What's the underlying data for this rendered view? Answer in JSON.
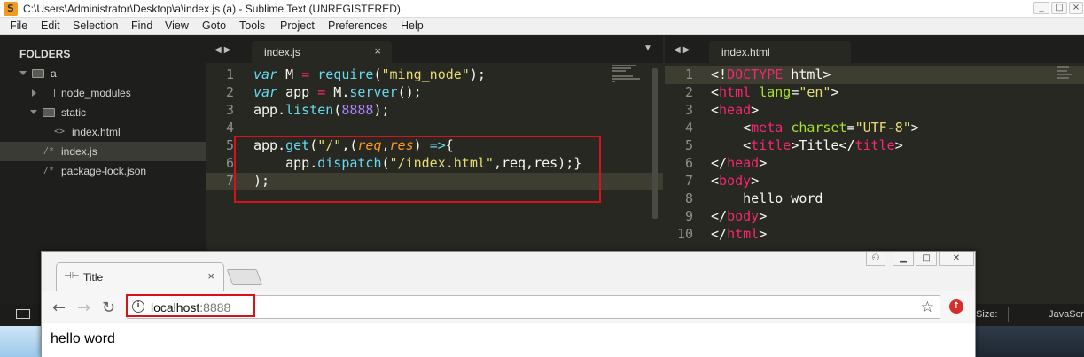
{
  "sublime": {
    "window_title": "C:\\Users\\Administrator\\Desktop\\a\\index.js (a) - Sublime Text (UNREGISTERED)",
    "menu": [
      "File",
      "Edit",
      "Selection",
      "Find",
      "View",
      "Goto",
      "Tools",
      "Project",
      "Preferences",
      "Help"
    ],
    "folders_header": "FOLDERS",
    "tree": {
      "root": "a",
      "node_modules": "node_modules",
      "static": "static",
      "index_html": "index.html",
      "index_js": "index.js",
      "package_lock": "package-lock.json"
    },
    "tabs": {
      "left": "index.js",
      "right": "index.html",
      "close": "×"
    },
    "left_code": {
      "line_numbers": [
        "1",
        "2",
        "3",
        "4",
        "5",
        "6",
        "7"
      ],
      "l1": {
        "a": "var",
        "b": " M ",
        "c": "=",
        "d": " ",
        "e": "require",
        "f": "(",
        "g": "\"ming_node\"",
        "h": ");"
      },
      "l2": {
        "a": "var",
        "b": " app ",
        "c": "=",
        "d": " M.",
        "e": "server",
        "f": "();"
      },
      "l3": {
        "a": "app.",
        "b": "listen",
        "c": "(",
        "d": "8888",
        "e": ");"
      },
      "l5": {
        "a": "app.",
        "b": "get",
        "c": "(",
        "d": "\"/\"",
        "e": ",(",
        "f": "req",
        "g": ",",
        "h": "res",
        "i": ") ",
        "j": "=>",
        "k": "{"
      },
      "l6": {
        "a": "    app.",
        "b": "dispatch",
        "c": "(",
        "d": "\"/index.html\"",
        "e": ",req,res);}"
      },
      "l7": ");"
    },
    "right_code": {
      "line_numbers": [
        "1",
        "2",
        "3",
        "4",
        "5",
        "6",
        "7",
        "8",
        "9",
        "10"
      ],
      "l1": {
        "a": "<!",
        "b": "DOCTYPE",
        "c": " html>"
      },
      "l2": {
        "a": "<",
        "b": "html",
        "c": " ",
        "d": "lang",
        "e": "=",
        "f": "\"en\"",
        "g": ">"
      },
      "l3": {
        "a": "<",
        "b": "head",
        "c": ">"
      },
      "l4": {
        "a": "    <",
        "b": "meta",
        "c": " ",
        "d": "charset",
        "e": "=",
        "f": "\"UTF-8\"",
        "g": ">"
      },
      "l5": {
        "a": "    <",
        "b": "title",
        "c": ">Title</",
        "d": "title",
        "e": ">"
      },
      "l6": {
        "a": "</",
        "b": "head",
        "c": ">"
      },
      "l7": {
        "a": "<",
        "b": "body",
        "c": ">"
      },
      "l8": "    hello word",
      "l9": {
        "a": "</",
        "b": "body",
        "c": ">"
      },
      "l10": {
        "a": "</",
        "b": "html",
        "c": ">"
      }
    },
    "status": {
      "size": "Size:",
      "syntax": "JavaScrip"
    }
  },
  "chrome": {
    "tab_title": "Title",
    "tab_close": "×",
    "url_host": "localhost",
    "url_port": ":8888",
    "page_text": "hello word"
  },
  "colors": {
    "editor_bg": "#272822",
    "sidebar_bg": "#1e1f1c",
    "highlight_box": "#d8121c",
    "keyword": "#66d9ef",
    "operator_tag": "#f92672",
    "string": "#e6db74",
    "number": "#ae81ff",
    "parameter": "#fd971f",
    "attribute": "#a6e22e"
  }
}
